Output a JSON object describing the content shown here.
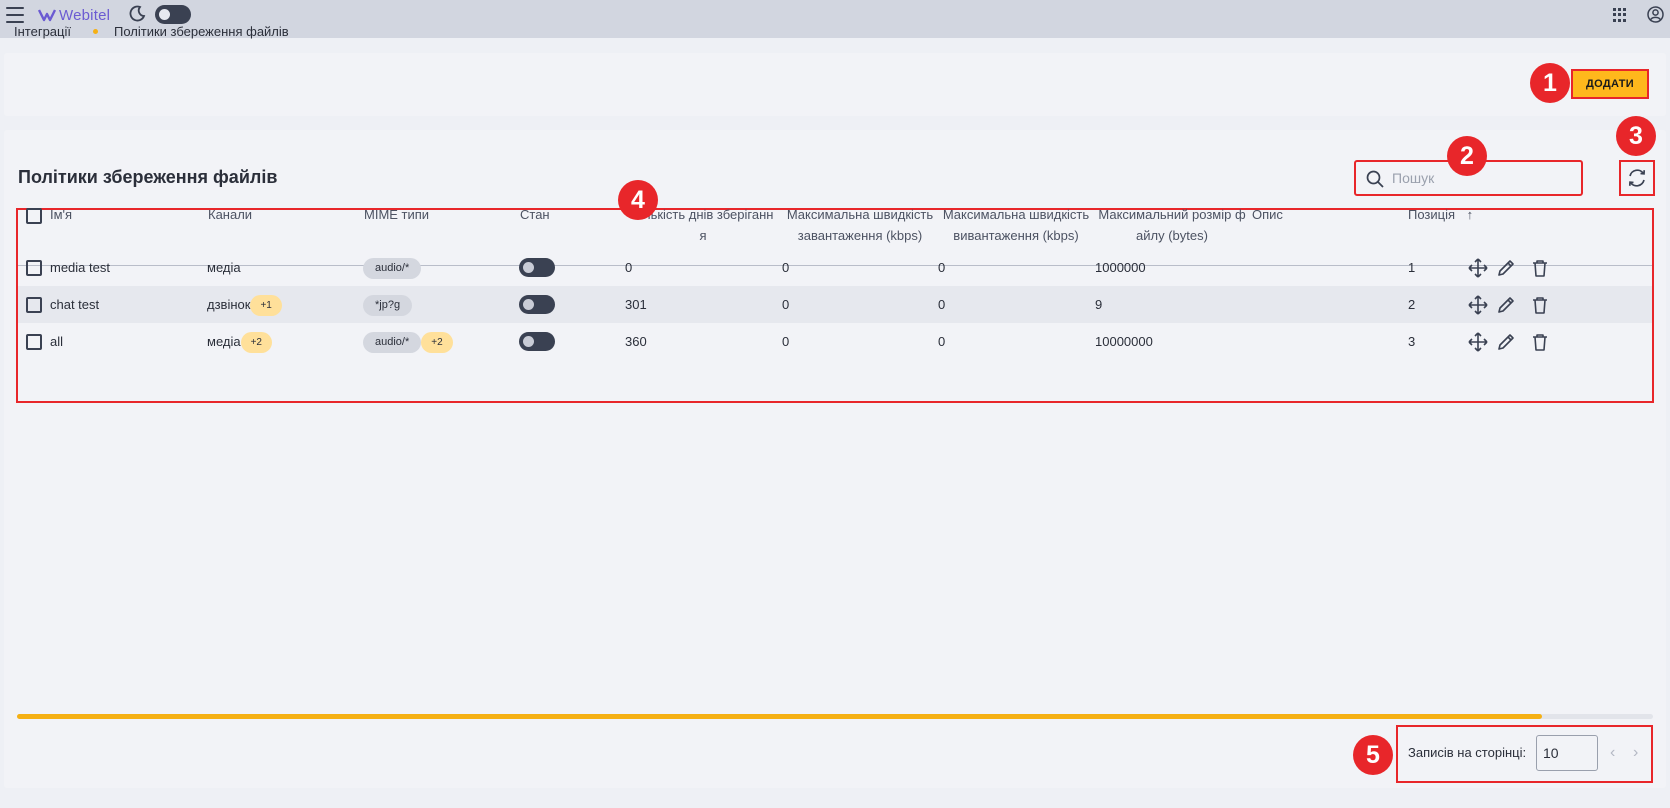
{
  "header": {
    "brand": "Webitel",
    "icons": {
      "menu": "hamburger-icon",
      "theme": "moon-icon",
      "apps": "apps-grid-icon",
      "account": "account-icon"
    }
  },
  "breadcrumb": {
    "parent": "Інтеграції",
    "current": "Політики збереження файлів"
  },
  "toolbar": {
    "add_label": "ДОДАТИ"
  },
  "page": {
    "title": "Політики збереження файлів"
  },
  "search": {
    "placeholder": "Пошук",
    "value": ""
  },
  "table": {
    "columns": {
      "name": "Ім'я",
      "channels": "Канали",
      "mime": "MIME типи",
      "state": "Стан",
      "retention_line1": "Кількість днів зберіганн",
      "retention_line2": "я",
      "upload_line1": "Максимальна швидкість",
      "upload_line2": "завантаження (kbps)",
      "download_line1": "Максимальна швидкість",
      "download_line2": "вивантаження (kbps)",
      "maxsize_line1": "Максимальний розмір ф",
      "maxsize_line2": "айлу (bytes)",
      "description": "Опис",
      "position": "Позиція",
      "sort_indicator": "↑"
    },
    "rows": [
      {
        "name": "media test",
        "channel": "медіа",
        "channel_more": "",
        "mime": "audio/*",
        "mime_more": "",
        "state_enabled": false,
        "retention_days": "0",
        "upload_speed": "0",
        "download_speed": "0",
        "max_size": "1000000",
        "description": "",
        "position": "1"
      },
      {
        "name": "chat test",
        "channel": "дзвінок",
        "channel_more": "+1",
        "mime": "*jp?g",
        "mime_more": "",
        "state_enabled": false,
        "retention_days": "301",
        "upload_speed": "0",
        "download_speed": "0",
        "max_size": "9",
        "description": "",
        "position": "2"
      },
      {
        "name": "all",
        "channel": "медіа",
        "channel_more": "+2",
        "mime": "audio/*",
        "mime_more": "+2",
        "state_enabled": false,
        "retention_days": "360",
        "upload_speed": "0",
        "download_speed": "0",
        "max_size": "10000000",
        "description": "",
        "position": "3"
      }
    ],
    "row_action_icons": [
      "move-icon",
      "edit-pencil-icon",
      "delete-trash-icon"
    ]
  },
  "pagination": {
    "label": "Записів на сторінці:",
    "page_size": "10"
  },
  "markers": [
    "1",
    "2",
    "3",
    "4",
    "5"
  ],
  "colors": {
    "accent": "#ffb81c",
    "highlight": "#e8262a",
    "dark": "#3a4152",
    "brand": "#6b5bd2"
  }
}
